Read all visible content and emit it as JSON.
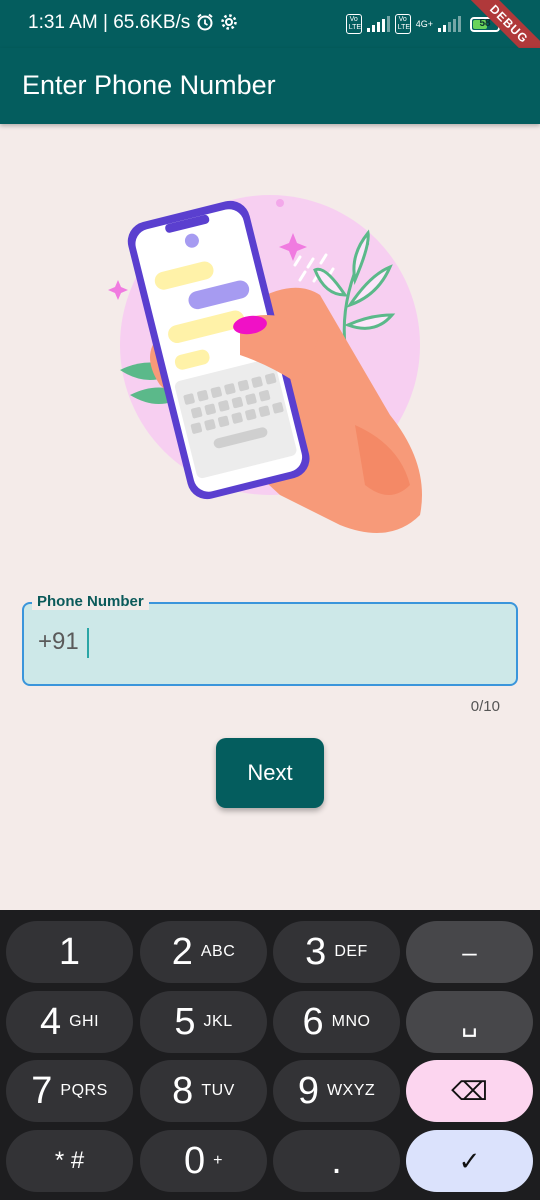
{
  "status_bar": {
    "time_speed": "1:31 AM | 65.6KB/s",
    "alarm_icon": "alarm-clock-icon",
    "settings_icon": "gear-icon",
    "volte_1": "Vo LTE",
    "volte_2": "Vo LTE",
    "network": "4G+",
    "battery_level": "58",
    "debug_banner": "DEBUG"
  },
  "app_bar": {
    "title": "Enter Phone Number"
  },
  "illustration": {
    "icon": "hand-holding-phone-chat-illustration"
  },
  "phone_field": {
    "label": "Phone Number",
    "prefix": "+91",
    "value": "",
    "counter": "0/10"
  },
  "next_button": {
    "label": "Next"
  },
  "keyboard": {
    "keys": [
      {
        "main": "1",
        "sub": ""
      },
      {
        "main": "2",
        "sub": "ABC"
      },
      {
        "main": "3",
        "sub": "DEF"
      },
      {
        "main": "–",
        "sub": ""
      },
      {
        "main": "4",
        "sub": "GHI"
      },
      {
        "main": "5",
        "sub": "JKL"
      },
      {
        "main": "6",
        "sub": "MNO"
      },
      {
        "main": "␣",
        "sub": ""
      },
      {
        "main": "7",
        "sub": "PQRS"
      },
      {
        "main": "8",
        "sub": "TUV"
      },
      {
        "main": "9",
        "sub": "WXYZ"
      },
      {
        "main": "⌫",
        "sub": ""
      },
      {
        "main": "* #",
        "sub": ""
      },
      {
        "main": "0",
        "sub": "+"
      },
      {
        "main": ".",
        "sub": ""
      },
      {
        "main": "✓",
        "sub": ""
      }
    ]
  },
  "colors": {
    "primary": "#045d5e",
    "background": "#f4ebe9",
    "field_fill": "#cde8e8",
    "field_border": "#3a95db",
    "keyboard_bg": "#1d1d1f",
    "backspace_key": "#fcd5ef",
    "done_key": "#dbe2fc"
  }
}
